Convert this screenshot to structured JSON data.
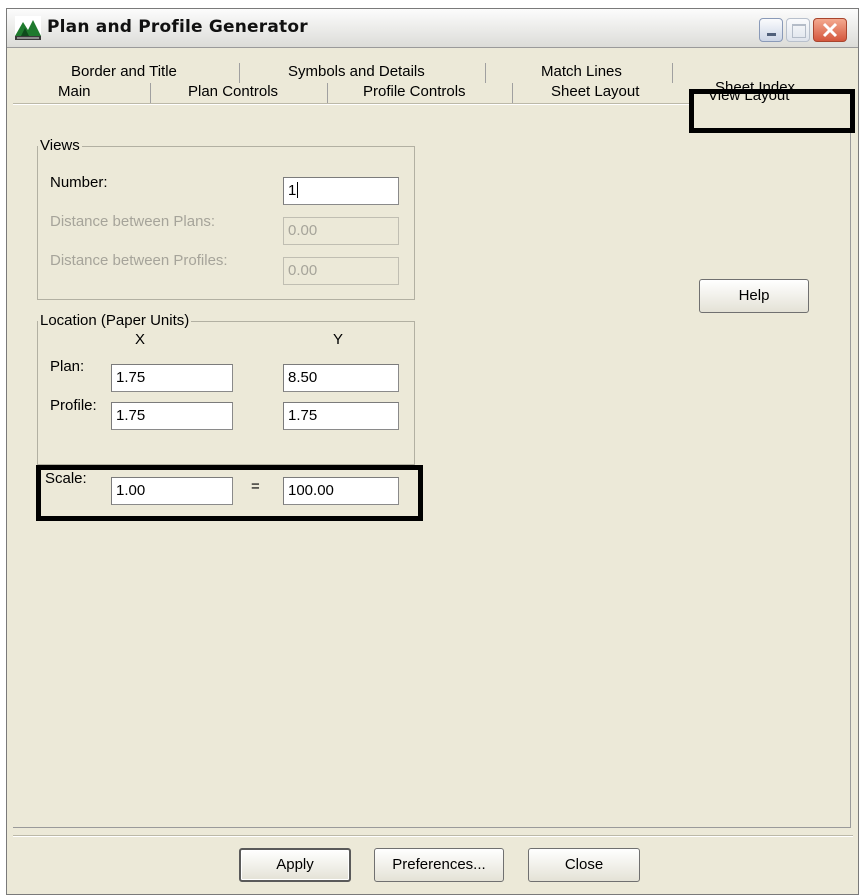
{
  "window": {
    "title": "Plan and Profile Generator",
    "icon": "plan-profile-app-icon"
  },
  "tabs": {
    "row_back": [
      "Border and Title",
      "Symbols and Details",
      "Match Lines",
      "Sheet Index"
    ],
    "row_front": [
      "Main",
      "Plan Controls",
      "Profile Controls",
      "Sheet Layout",
      "View Layout"
    ],
    "active": "View Layout"
  },
  "views": {
    "legend": "Views",
    "number_label": "Number:",
    "number_value": "1",
    "dist_plans_label": "Distance between Plans:",
    "dist_plans_value": "0.00",
    "dist_profiles_label": "Distance between Profiles:",
    "dist_profiles_value": "0.00"
  },
  "location": {
    "legend": "Location (Paper Units)",
    "x_header": "X",
    "y_header": "Y",
    "plan_label": "Plan:",
    "plan_x": "1.75",
    "plan_y": "8.50",
    "profile_label": "Profile:",
    "profile_x": "1.75",
    "profile_y": "1.75"
  },
  "scale": {
    "label": "Scale:",
    "left": "1.00",
    "equals": "=",
    "right": "100.00"
  },
  "buttons": {
    "help": "Help",
    "apply": "Apply",
    "preferences": "Preferences...",
    "close": "Close"
  },
  "colors": {
    "dialog_bg": "#ece9d8",
    "highlight": "#000000",
    "close_button": "#d4563c"
  }
}
